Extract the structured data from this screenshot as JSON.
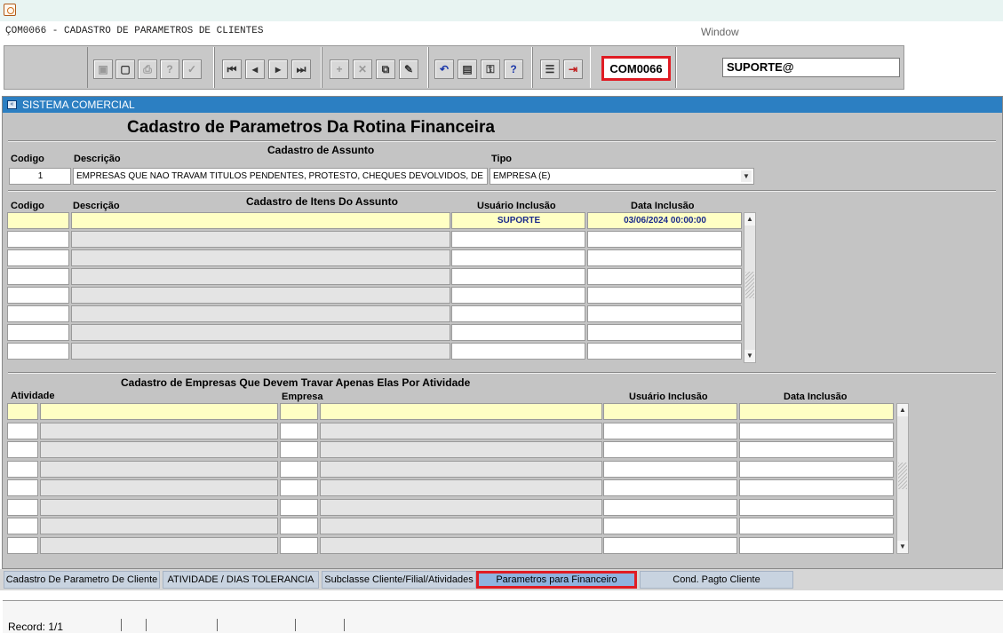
{
  "window": {
    "form_title": "ÇOM0066 - CADASTRO DE PARAMETROS DE CLIENTES",
    "menu_window": "Window"
  },
  "toolbar": {
    "form_code": "COM0066",
    "user": "SUPORTE@"
  },
  "panel": {
    "header": "SISTEMA COMERCIAL",
    "title": "Cadastro de Parametros Da Rotina Financeira"
  },
  "assunto": {
    "section_title": "Cadastro de Assunto",
    "col_codigo": "Codigo",
    "col_descricao": "Descrição",
    "col_tipo": "Tipo",
    "codigo": "1",
    "descricao": "EMPRESAS QUE NAO TRAVAM TITULOS PENDENTES, PROTESTO, CHEQUES DEVOLVIDOS, DE",
    "tipo": "EMPRESA (E)"
  },
  "itens": {
    "section_title": "Cadastro de Itens Do Assunto",
    "col_codigo": "Codigo",
    "col_descricao": "Descrição",
    "col_usuario": "Usuário Inclusão",
    "col_data": "Data Inclusão",
    "rows": [
      {
        "codigo": "",
        "descricao": "",
        "usuario": "SUPORTE",
        "data": "03/06/2024 00:00:00"
      },
      {
        "codigo": "",
        "descricao": "",
        "usuario": "",
        "data": ""
      },
      {
        "codigo": "",
        "descricao": "",
        "usuario": "",
        "data": ""
      },
      {
        "codigo": "",
        "descricao": "",
        "usuario": "",
        "data": ""
      },
      {
        "codigo": "",
        "descricao": "",
        "usuario": "",
        "data": ""
      },
      {
        "codigo": "",
        "descricao": "",
        "usuario": "",
        "data": ""
      },
      {
        "codigo": "",
        "descricao": "",
        "usuario": "",
        "data": ""
      },
      {
        "codigo": "",
        "descricao": "",
        "usuario": "",
        "data": ""
      }
    ]
  },
  "empresas": {
    "section_title": "Cadastro de Empresas Que Devem Travar Apenas Elas Por Atividade",
    "col_atividade": "Atividade",
    "col_empresa": "Empresa",
    "col_usuario": "Usuário Inclusão",
    "col_data": "Data Inclusão",
    "rows": [
      {
        "atividade": "",
        "atividade_desc": "",
        "empresa": "",
        "empresa_desc": "",
        "usuario": "",
        "data": ""
      },
      {
        "atividade": "",
        "atividade_desc": "",
        "empresa": "",
        "empresa_desc": "",
        "usuario": "",
        "data": ""
      },
      {
        "atividade": "",
        "atividade_desc": "",
        "empresa": "",
        "empresa_desc": "",
        "usuario": "",
        "data": ""
      },
      {
        "atividade": "",
        "atividade_desc": "",
        "empresa": "",
        "empresa_desc": "",
        "usuario": "",
        "data": ""
      },
      {
        "atividade": "",
        "atividade_desc": "",
        "empresa": "",
        "empresa_desc": "",
        "usuario": "",
        "data": ""
      },
      {
        "atividade": "",
        "atividade_desc": "",
        "empresa": "",
        "empresa_desc": "",
        "usuario": "",
        "data": ""
      },
      {
        "atividade": "",
        "atividade_desc": "",
        "empresa": "",
        "empresa_desc": "",
        "usuario": "",
        "data": ""
      },
      {
        "atividade": "",
        "atividade_desc": "",
        "empresa": "",
        "empresa_desc": "",
        "usuario": "",
        "data": ""
      }
    ]
  },
  "tabs": [
    {
      "label": "Cadastro De Parametro De Cliente",
      "active": false
    },
    {
      "label": "ATIVIDADE / DIAS TOLERANCIA",
      "active": false
    },
    {
      "label": "Subclasse Cliente/Filial/Atividades",
      "active": false
    },
    {
      "label": "Parametros para Financeiro",
      "active": true
    },
    {
      "label": "Cond. Pagto Cliente",
      "active": false
    }
  ],
  "status": {
    "record": "Record: 1/1"
  },
  "colors": {
    "accent_blue": "#2c7fc2",
    "highlight_red": "#e01c24",
    "current_row": "#ffffc4"
  }
}
